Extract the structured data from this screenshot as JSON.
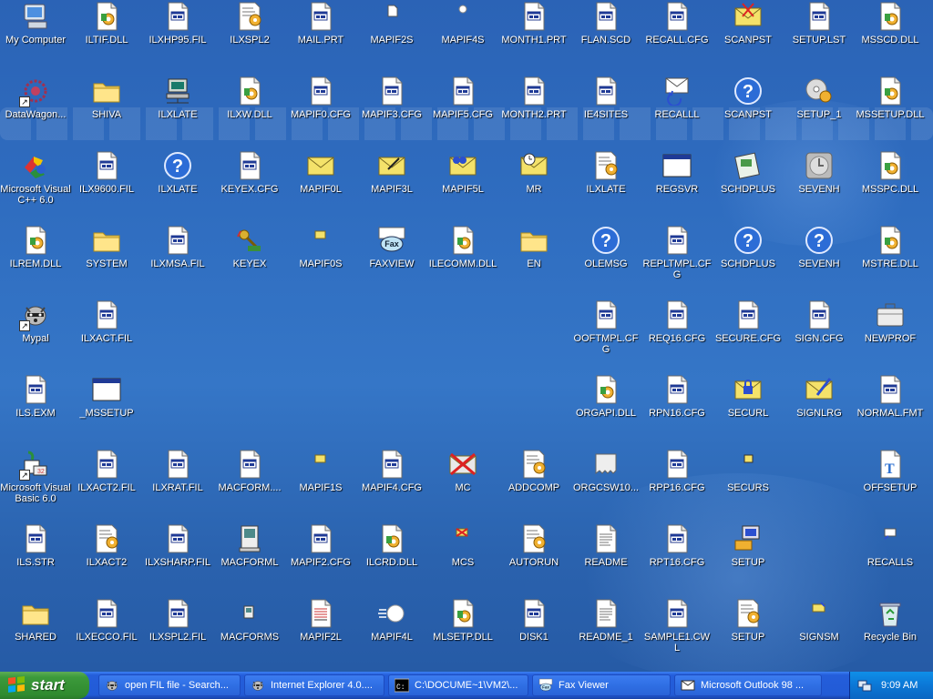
{
  "desktop": {
    "icons": [
      {
        "label": "My Computer",
        "icon": "computer-icon",
        "col": 0,
        "row": 0
      },
      {
        "label": "ILTIF.DLL",
        "icon": "dll-file-icon",
        "col": 1,
        "row": 0
      },
      {
        "label": "ILXHP95.FIL",
        "icon": "fil-file-icon",
        "col": 2,
        "row": 0
      },
      {
        "label": "ILXSPL2",
        "icon": "config-file-icon",
        "col": 3,
        "row": 0
      },
      {
        "label": "MAIL.PRT",
        "icon": "fil-file-icon",
        "col": 4,
        "row": 0
      },
      {
        "label": "MAPIF2S",
        "icon": "small-doc-icon",
        "col": 5,
        "row": 0
      },
      {
        "label": "MAPIF4S",
        "icon": "small-bullet-icon",
        "col": 6,
        "row": 0
      },
      {
        "label": "MONTH1.PRT",
        "icon": "fil-file-icon",
        "col": 7,
        "row": 0
      },
      {
        "label": "FLAN.SCD",
        "icon": "fil-file-icon",
        "col": 8,
        "row": 0
      },
      {
        "label": "RECALL.CFG",
        "icon": "fil-file-icon",
        "col": 9,
        "row": 0
      },
      {
        "label": "SCANPST",
        "icon": "scanpst-envelope-icon",
        "col": 10,
        "row": 0
      },
      {
        "label": "SETUP.LST",
        "icon": "fil-file-icon",
        "col": 11,
        "row": 0
      },
      {
        "label": "MSSCD.DLL",
        "icon": "dll-file-icon",
        "col": 12,
        "row": 0
      },
      {
        "label": "DataWagon...",
        "icon": "datawagon-icon",
        "col": 0,
        "row": 1,
        "shortcut": true
      },
      {
        "label": "SHIVA",
        "icon": "folder-icon",
        "col": 1,
        "row": 1
      },
      {
        "label": "ILXLATE",
        "icon": "network-computer-icon",
        "col": 2,
        "row": 1
      },
      {
        "label": "ILXW.DLL",
        "icon": "dll-file-icon",
        "col": 3,
        "row": 1
      },
      {
        "label": "MAPIF0.CFG",
        "icon": "fil-file-icon",
        "col": 4,
        "row": 1
      },
      {
        "label": "MAPIF3.CFG",
        "icon": "fil-file-icon",
        "col": 5,
        "row": 1
      },
      {
        "label": "MAPIF5.CFG",
        "icon": "fil-file-icon",
        "col": 6,
        "row": 1
      },
      {
        "label": "MONTH2.PRT",
        "icon": "fil-file-icon",
        "col": 7,
        "row": 1
      },
      {
        "label": "IE4SITES",
        "icon": "fil-file-icon",
        "col": 8,
        "row": 1
      },
      {
        "label": "RECALLL",
        "icon": "recall-envelope-icon",
        "col": 9,
        "row": 1
      },
      {
        "label": "SCANPST",
        "icon": "help-icon",
        "col": 10,
        "row": 1
      },
      {
        "label": "SETUP_1",
        "icon": "cd-setup-icon",
        "col": 11,
        "row": 1
      },
      {
        "label": "MSSETUP.DLL",
        "icon": "dll-file-icon",
        "col": 12,
        "row": 1
      },
      {
        "label": "Microsoft Visual C++ 6.0",
        "icon": "visual-cpp-icon",
        "col": 0,
        "row": 2
      },
      {
        "label": "ILX9600.FIL",
        "icon": "fil-file-icon",
        "col": 1,
        "row": 2
      },
      {
        "label": "ILXLATE",
        "icon": "help-icon",
        "col": 2,
        "row": 2
      },
      {
        "label": "KEYEX.CFG",
        "icon": "fil-file-icon",
        "col": 3,
        "row": 2
      },
      {
        "label": "MAPIF0L",
        "icon": "yellow-envelope-icon",
        "col": 4,
        "row": 2
      },
      {
        "label": "MAPIF3L",
        "icon": "pen-envelope-icon",
        "col": 5,
        "row": 2
      },
      {
        "label": "MAPIF5L",
        "icon": "binoculars-envelope-icon",
        "col": 6,
        "row": 2
      },
      {
        "label": "MR",
        "icon": "clock-envelope-icon",
        "col": 7,
        "row": 2
      },
      {
        "label": "ILXLATE",
        "icon": "config-file-icon",
        "col": 8,
        "row": 2
      },
      {
        "label": "REGSVR",
        "icon": "window-icon",
        "col": 9,
        "row": 2
      },
      {
        "label": "SCHDPLUS",
        "icon": "schedule-icon",
        "col": 10,
        "row": 2
      },
      {
        "label": "SEVENH",
        "icon": "gray-disc-icon",
        "col": 11,
        "row": 2
      },
      {
        "label": "MSSPC.DLL",
        "icon": "dll-file-icon",
        "col": 12,
        "row": 2
      },
      {
        "label": "ILREM.DLL",
        "icon": "dll-file-icon",
        "col": 0,
        "row": 3
      },
      {
        "label": "SYSTEM",
        "icon": "folder-icon",
        "col": 1,
        "row": 3
      },
      {
        "label": "ILXMSA.FIL",
        "icon": "fil-file-icon",
        "col": 2,
        "row": 3
      },
      {
        "label": "KEYEX",
        "icon": "keyex-icon",
        "col": 3,
        "row": 3
      },
      {
        "label": "MAPIF0S",
        "icon": "small-envelope-icon",
        "col": 4,
        "row": 3
      },
      {
        "label": "FAXVIEW",
        "icon": "fax-icon",
        "col": 5,
        "row": 3
      },
      {
        "label": "ILECOMM.DLL",
        "icon": "dll-file-icon",
        "col": 6,
        "row": 3
      },
      {
        "label": "EN",
        "icon": "folder-icon",
        "col": 7,
        "row": 3
      },
      {
        "label": "OLEMSG",
        "icon": "help-icon",
        "col": 8,
        "row": 3
      },
      {
        "label": "REPLTMPL.CFG",
        "icon": "fil-file-icon",
        "col": 9,
        "row": 3
      },
      {
        "label": "SCHDPLUS",
        "icon": "help-icon",
        "col": 10,
        "row": 3
      },
      {
        "label": "SEVENH",
        "icon": "help-icon",
        "col": 11,
        "row": 3
      },
      {
        "label": "MSTRE.DLL",
        "icon": "dll-file-icon",
        "col": 12,
        "row": 3
      },
      {
        "label": "Mypal",
        "icon": "raccoon-icon",
        "col": 0,
        "row": 4,
        "shortcut": true
      },
      {
        "label": "ILXACT.FIL",
        "icon": "fil-file-icon",
        "col": 1,
        "row": 4
      },
      {
        "label": "OOFTMPL.CFG",
        "icon": "fil-file-icon",
        "col": 8,
        "row": 4
      },
      {
        "label": "REQ16.CFG",
        "icon": "fil-file-icon",
        "col": 9,
        "row": 4
      },
      {
        "label": "SECURE.CFG",
        "icon": "fil-file-icon",
        "col": 10,
        "row": 4
      },
      {
        "label": "SIGN.CFG",
        "icon": "fil-file-icon",
        "col": 11,
        "row": 4
      },
      {
        "label": "NEWPROF",
        "icon": "briefcase-icon",
        "col": 12,
        "row": 4
      },
      {
        "label": "ILS.EXM",
        "icon": "fil-file-icon",
        "col": 0,
        "row": 5
      },
      {
        "label": "_MSSETUP",
        "icon": "window-icon",
        "col": 1,
        "row": 5
      },
      {
        "label": "ORGAPI.DLL",
        "icon": "dll-file-icon",
        "col": 8,
        "row": 5
      },
      {
        "label": "RPN16.CFG",
        "icon": "fil-file-icon",
        "col": 9,
        "row": 5
      },
      {
        "label": "SECURL",
        "icon": "lock-envelope-icon",
        "col": 10,
        "row": 5
      },
      {
        "label": "SIGNLRG",
        "icon": "sign-envelope-icon",
        "col": 11,
        "row": 5
      },
      {
        "label": "NORMAL.FMT",
        "icon": "fil-file-icon",
        "col": 12,
        "row": 5
      },
      {
        "label": "Microsoft Visual Basic 6.0",
        "icon": "visual-basic-icon",
        "col": 0,
        "row": 6,
        "shortcut": true
      },
      {
        "label": "ILXACT2.FIL",
        "icon": "fil-file-icon",
        "col": 1,
        "row": 6
      },
      {
        "label": "ILXRAT.FIL",
        "icon": "fil-file-icon",
        "col": 2,
        "row": 6
      },
      {
        "label": "MACFORM....",
        "icon": "fil-file-icon",
        "col": 3,
        "row": 6
      },
      {
        "label": "MAPIF1S",
        "icon": "small-envelope-icon",
        "col": 4,
        "row": 6
      },
      {
        "label": "MAPIF4.CFG",
        "icon": "fil-file-icon",
        "col": 5,
        "row": 6
      },
      {
        "label": "MC",
        "icon": "crossed-envelope-icon",
        "col": 6,
        "row": 6
      },
      {
        "label": "ADDCOMP",
        "icon": "config-file-icon",
        "col": 7,
        "row": 6
      },
      {
        "label": "ORGCSW10...",
        "icon": "torn-page-icon",
        "col": 8,
        "row": 6
      },
      {
        "label": "RPP16.CFG",
        "icon": "fil-file-icon",
        "col": 9,
        "row": 6
      },
      {
        "label": "SECURS",
        "icon": "small-lock-icon",
        "col": 10,
        "row": 6
      },
      {
        "label": "OFFSETUP",
        "icon": "font-file-icon",
        "col": 12,
        "row": 6
      },
      {
        "label": "ILS.STR",
        "icon": "fil-file-icon",
        "col": 0,
        "row": 7
      },
      {
        "label": "ILXACT2",
        "icon": "config-file-icon",
        "col": 1,
        "row": 7
      },
      {
        "label": "ILXSHARP.FIL",
        "icon": "fil-file-icon",
        "col": 2,
        "row": 7
      },
      {
        "label": "MACFORML",
        "icon": "mac-icon",
        "col": 3,
        "row": 7
      },
      {
        "label": "MAPIF2.CFG",
        "icon": "fil-file-icon",
        "col": 4,
        "row": 7
      },
      {
        "label": "ILCRD.DLL",
        "icon": "dll-file-icon",
        "col": 5,
        "row": 7
      },
      {
        "label": "MCS",
        "icon": "small-crossed-envelope-icon",
        "col": 6,
        "row": 7
      },
      {
        "label": "AUTORUN",
        "icon": "config-file-icon",
        "col": 7,
        "row": 7
      },
      {
        "label": "README",
        "icon": "text-file-icon",
        "col": 8,
        "row": 7
      },
      {
        "label": "RPT16.CFG",
        "icon": "fil-file-icon",
        "col": 9,
        "row": 7
      },
      {
        "label": "SETUP",
        "icon": "setup-computer-icon",
        "col": 10,
        "row": 7
      },
      {
        "label": "RECALLS",
        "icon": "small-recall-icon",
        "col": 12,
        "row": 7
      },
      {
        "label": "SHARED",
        "icon": "folder-icon",
        "col": 0,
        "row": 8
      },
      {
        "label": "ILXECCO.FIL",
        "icon": "fil-file-icon",
        "col": 1,
        "row": 8
      },
      {
        "label": "ILXSPL2.FIL",
        "icon": "fil-file-icon",
        "col": 2,
        "row": 8
      },
      {
        "label": "MACFORMS",
        "icon": "small-mac-icon",
        "col": 3,
        "row": 8
      },
      {
        "label": "MAPIF2L",
        "icon": "form-doc-icon",
        "col": 4,
        "row": 8
      },
      {
        "label": "MAPIF4L",
        "icon": "ball-icon",
        "col": 5,
        "row": 8
      },
      {
        "label": "MLSETP.DLL",
        "icon": "dll-file-icon",
        "col": 6,
        "row": 8
      },
      {
        "label": "DISK1",
        "icon": "fil-file-icon",
        "col": 7,
        "row": 8
      },
      {
        "label": "README_1",
        "icon": "text-file-icon",
        "col": 8,
        "row": 8
      },
      {
        "label": "SAMPLE1.CWL",
        "icon": "fil-file-icon",
        "col": 9,
        "row": 8
      },
      {
        "label": "SETUP",
        "icon": "config-file-icon",
        "col": 10,
        "row": 8
      },
      {
        "label": "SIGNSM",
        "icon": "small-sign-envelope-icon",
        "col": 11,
        "row": 8
      },
      {
        "label": "Recycle Bin",
        "icon": "recycle-bin-icon",
        "col": 12,
        "row": 8
      }
    ]
  },
  "taskbar": {
    "start_label": "start",
    "tasks": [
      {
        "label": "open FIL file - Search...",
        "icon": "raccoon-icon"
      },
      {
        "label": "Internet Explorer 4.0....",
        "icon": "raccoon-icon"
      },
      {
        "label": "C:\\DOCUME~1\\VM2\\...",
        "icon": "cmd-icon"
      },
      {
        "label": "Fax Viewer",
        "icon": "fax-icon"
      },
      {
        "label": "Microsoft Outlook 98 ...",
        "icon": "outlook-icon"
      }
    ],
    "tray": {
      "clock": "9:09 AM"
    }
  }
}
